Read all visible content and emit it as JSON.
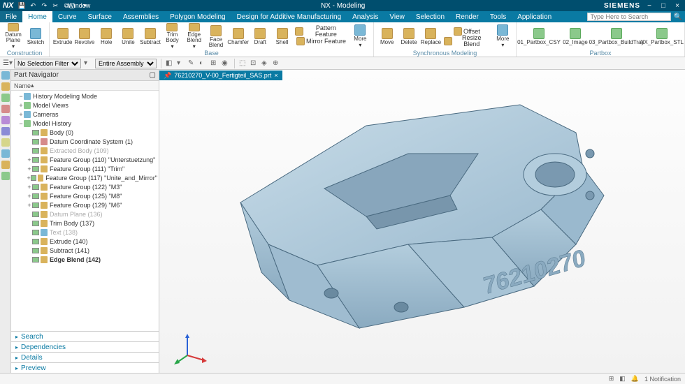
{
  "title": "NX - Modeling",
  "brand": "SIEMENS",
  "qat": {
    "window_label": "Window"
  },
  "search": {
    "placeholder": "Type Here to Search"
  },
  "menu": {
    "file": "File",
    "tabs": [
      "Home",
      "Curve",
      "Surface",
      "Assemblies",
      "Polygon Modeling",
      "Design for Additive Manufacturing",
      "Analysis",
      "View",
      "Selection",
      "Render",
      "Tools",
      "Application"
    ],
    "active": "Home"
  },
  "ribbon": {
    "groups": [
      {
        "label": "Construction",
        "items": [
          {
            "l": "Datum Plane"
          },
          {
            "l": "Sketch"
          }
        ]
      },
      {
        "label": "Base",
        "items": [
          {
            "l": "Extrude"
          },
          {
            "l": "Revolve"
          },
          {
            "l": "Hole"
          },
          {
            "l": "Unite"
          },
          {
            "l": "Subtract"
          },
          {
            "l": "Trim Body"
          },
          {
            "l": "Edge Blend"
          },
          {
            "l": "Face Blend"
          },
          {
            "l": "Chamfer"
          },
          {
            "l": "Draft"
          },
          {
            "l": "Shell"
          }
        ],
        "extras": [
          "Pattern Feature",
          "Mirror Feature"
        ],
        "more": "More"
      },
      {
        "label": "Synchronous Modeling",
        "items": [
          {
            "l": "Move"
          },
          {
            "l": "Delete"
          },
          {
            "l": "Replace"
          }
        ],
        "extras": [
          "Offset",
          "Resize Blend"
        ],
        "more": "More"
      },
      {
        "label": "Partbox",
        "items": [
          {
            "l": "01_Partbox_CSY"
          },
          {
            "l": "02_Image"
          },
          {
            "l": "03_Partbox_BuildTray"
          },
          {
            "l": "XX_Partbox_STL"
          }
        ]
      }
    ]
  },
  "toolbar2": {
    "filter": "No Selection Filter",
    "scope": "Entire Assembly"
  },
  "navigator": {
    "title": "Part Navigator",
    "col": "Name",
    "sections": [
      "Search",
      "Dependencies",
      "Details",
      "Preview"
    ],
    "tree": [
      {
        "lvl": 1,
        "exp": "−",
        "ico": "blue",
        "t": "History Modeling Mode"
      },
      {
        "lvl": 1,
        "exp": "+",
        "ico": "grn",
        "t": "Model Views"
      },
      {
        "lvl": 1,
        "exp": "+",
        "ico": "blue",
        "t": "Cameras"
      },
      {
        "lvl": 1,
        "exp": "−",
        "ico": "grn",
        "t": "Model History"
      },
      {
        "lvl": 2,
        "chk": 1,
        "ico": "",
        "t": "Body (0)"
      },
      {
        "lvl": 2,
        "chk": 1,
        "ico": "red",
        "t": "Datum Coordinate System (1)"
      },
      {
        "lvl": 2,
        "chk": 1,
        "ico": "",
        "t": "Extracted Body (109)",
        "gray": 1
      },
      {
        "lvl": 2,
        "exp": "+",
        "chk": 1,
        "ico": "",
        "t": "Feature Group (110) \"Unterstuetzung\""
      },
      {
        "lvl": 2,
        "exp": "+",
        "chk": 1,
        "ico": "",
        "t": "Feature Group (111) \"Trim\""
      },
      {
        "lvl": 2,
        "exp": "+",
        "chk": 1,
        "ico": "",
        "t": "Feature Group (117) \"Unite_and_Mirror\""
      },
      {
        "lvl": 2,
        "exp": "+",
        "chk": 1,
        "ico": "",
        "t": "Feature Group (122) \"M3\""
      },
      {
        "lvl": 2,
        "exp": "+",
        "chk": 1,
        "ico": "",
        "t": "Feature Group (125) \"M8\""
      },
      {
        "lvl": 2,
        "exp": "+",
        "chk": 1,
        "ico": "",
        "t": "Feature Group (129) \"M6\""
      },
      {
        "lvl": 2,
        "chk": 1,
        "ico": "",
        "t": "Datum Plane (136)",
        "gray": 1
      },
      {
        "lvl": 2,
        "chk": 1,
        "ico": "",
        "t": "Trim Body (137)"
      },
      {
        "lvl": 2,
        "chk": 1,
        "ico": "blue",
        "t": "Text (138)",
        "gray": 1
      },
      {
        "lvl": 2,
        "chk": 1,
        "ico": "",
        "t": "Extrude (140)"
      },
      {
        "lvl": 2,
        "chk": 1,
        "ico": "",
        "t": "Subtract (141)"
      },
      {
        "lvl": 2,
        "chk": 1,
        "ico": "",
        "t": "Edge Blend (142)",
        "bold": 1
      }
    ]
  },
  "viewport": {
    "tab": "76210270_V-00_Fertigteil_SAS.prt",
    "part_text": "76210270"
  },
  "status": {
    "notification": "1 Notification"
  }
}
